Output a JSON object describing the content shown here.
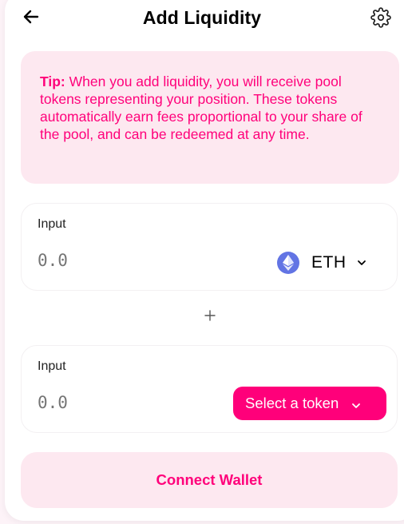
{
  "header": {
    "title": "Add Liquidity"
  },
  "tip": {
    "label": "Tip:",
    "text": " When you add liquidity, you will receive pool tokens representing your position. These tokens automatically earn fees proportional to your share of the pool, and can be redeemed at any time."
  },
  "inputs": [
    {
      "label": "Input",
      "placeholder": "0.0",
      "token": "ETH"
    },
    {
      "label": "Input",
      "placeholder": "0.0",
      "select_label": "Select a token"
    }
  ],
  "connect_button": "Connect Wallet",
  "colors": {
    "accent": "#ff007a",
    "accent_light": "#fde8f0",
    "eth_blue": "#6274e4"
  }
}
